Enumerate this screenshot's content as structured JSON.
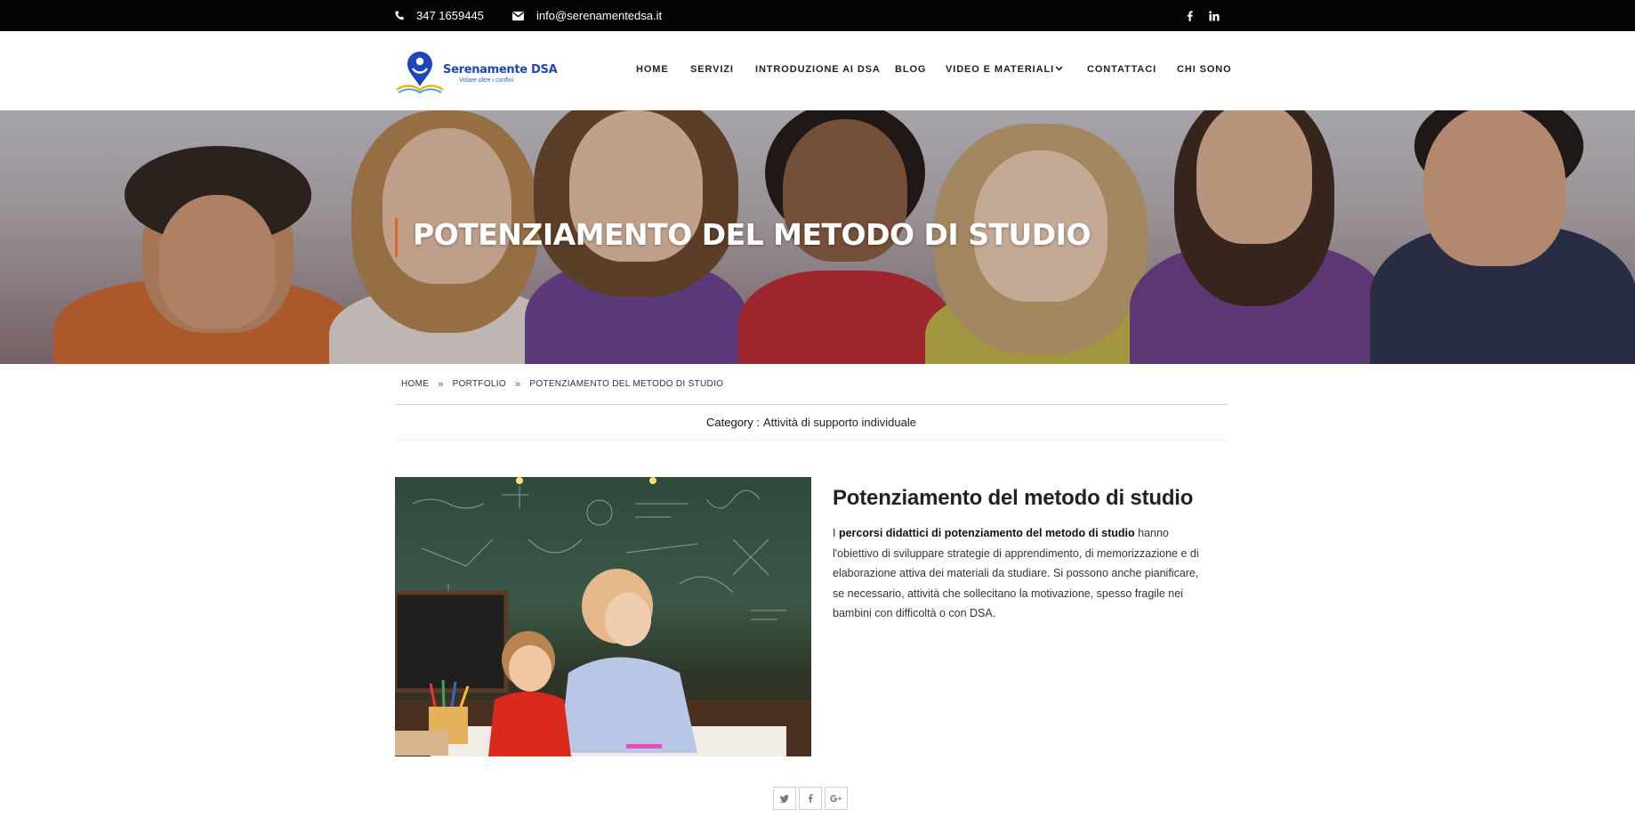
{
  "topbar": {
    "phone": "347 1659445",
    "email": "info@serenamentedsa.it",
    "social": [
      {
        "name": "facebook-icon",
        "glyph": "f"
      },
      {
        "name": "linkedin-icon",
        "glyph": "in"
      }
    ]
  },
  "logo": {
    "name": "Serenamente DSA",
    "tagline": "Volare oltre i confini"
  },
  "nav": {
    "items": [
      "HOME",
      "SERVIZI",
      "INTRODUZIONE AI DSA",
      "BLOG",
      "VIDEO E MATERIALI",
      "CONTATTACI",
      "CHI SONO"
    ]
  },
  "hero": {
    "title": "POTENZIAMENTO DEL METODO DI STUDIO"
  },
  "breadcrumb": {
    "items": [
      "HOME",
      "PORTFOLIO",
      "POTENZIAMENTO DEL METODO DI STUDIO"
    ],
    "separator": "»"
  },
  "category": {
    "label": "Category :",
    "value": "Attività di supporto individuale"
  },
  "article": {
    "title": "Potenziamento del metodo di studio",
    "intro": "I",
    "bold": "percorsi didattici di potenziamento del metodo di studio",
    "body": "hanno l'obiettivo di sviluppare strategie di apprendimento, di memorizzazione e di elaborazione attiva dei materiali da studiare. Si possono anche pianificare, se necessario, attività che sollecitano la motivazione, spesso fragile nei bambini con difficoltà o con DSA."
  },
  "share": [
    {
      "name": "twitter-share-icon",
      "glyph": "t"
    },
    {
      "name": "facebook-share-icon",
      "glyph": "f"
    },
    {
      "name": "google-plus-share-icon",
      "glyph": "G+"
    }
  ],
  "colors": {
    "topbar_bg": "#050505",
    "accent": "#e0651f",
    "logo_blue": "#1f47b8"
  }
}
